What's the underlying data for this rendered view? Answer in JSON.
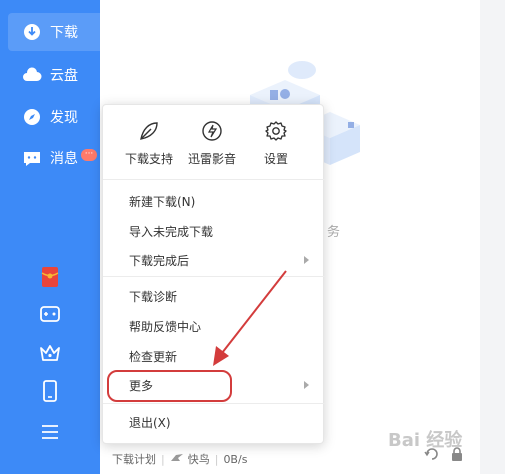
{
  "sidebar": {
    "items": [
      {
        "label": "下载",
        "icon": "download-icon",
        "active": true
      },
      {
        "label": "云盘",
        "icon": "cloud-icon"
      },
      {
        "label": "发现",
        "icon": "compass-icon"
      },
      {
        "label": "消息",
        "icon": "message-icon",
        "badge": "···"
      }
    ],
    "bottom_icons": [
      "red-envelope-icon",
      "gamepad-icon",
      "crown-icon",
      "phone-icon",
      "menu-icon"
    ]
  },
  "menu": {
    "quick": [
      {
        "label": "下载支持",
        "icon": "download-support-icon"
      },
      {
        "label": "迅雷影音",
        "icon": "media-player-icon"
      },
      {
        "label": "设置",
        "icon": "gear-icon"
      }
    ],
    "group1": [
      "新建下载(N)",
      "导入未完成下载",
      "下载完成后"
    ],
    "group2": [
      "下载诊断",
      "帮助反馈中心",
      "检查更新",
      "更多"
    ],
    "exit": "退出(X)"
  },
  "empty_text": "务",
  "bottom": {
    "plan": "下载计划",
    "mode": "快鸟",
    "speed": "0B/s"
  },
  "watermark": "Bai 经验",
  "colors": {
    "sidebar": "#3d8af7",
    "highlight": "#d33c3c"
  }
}
